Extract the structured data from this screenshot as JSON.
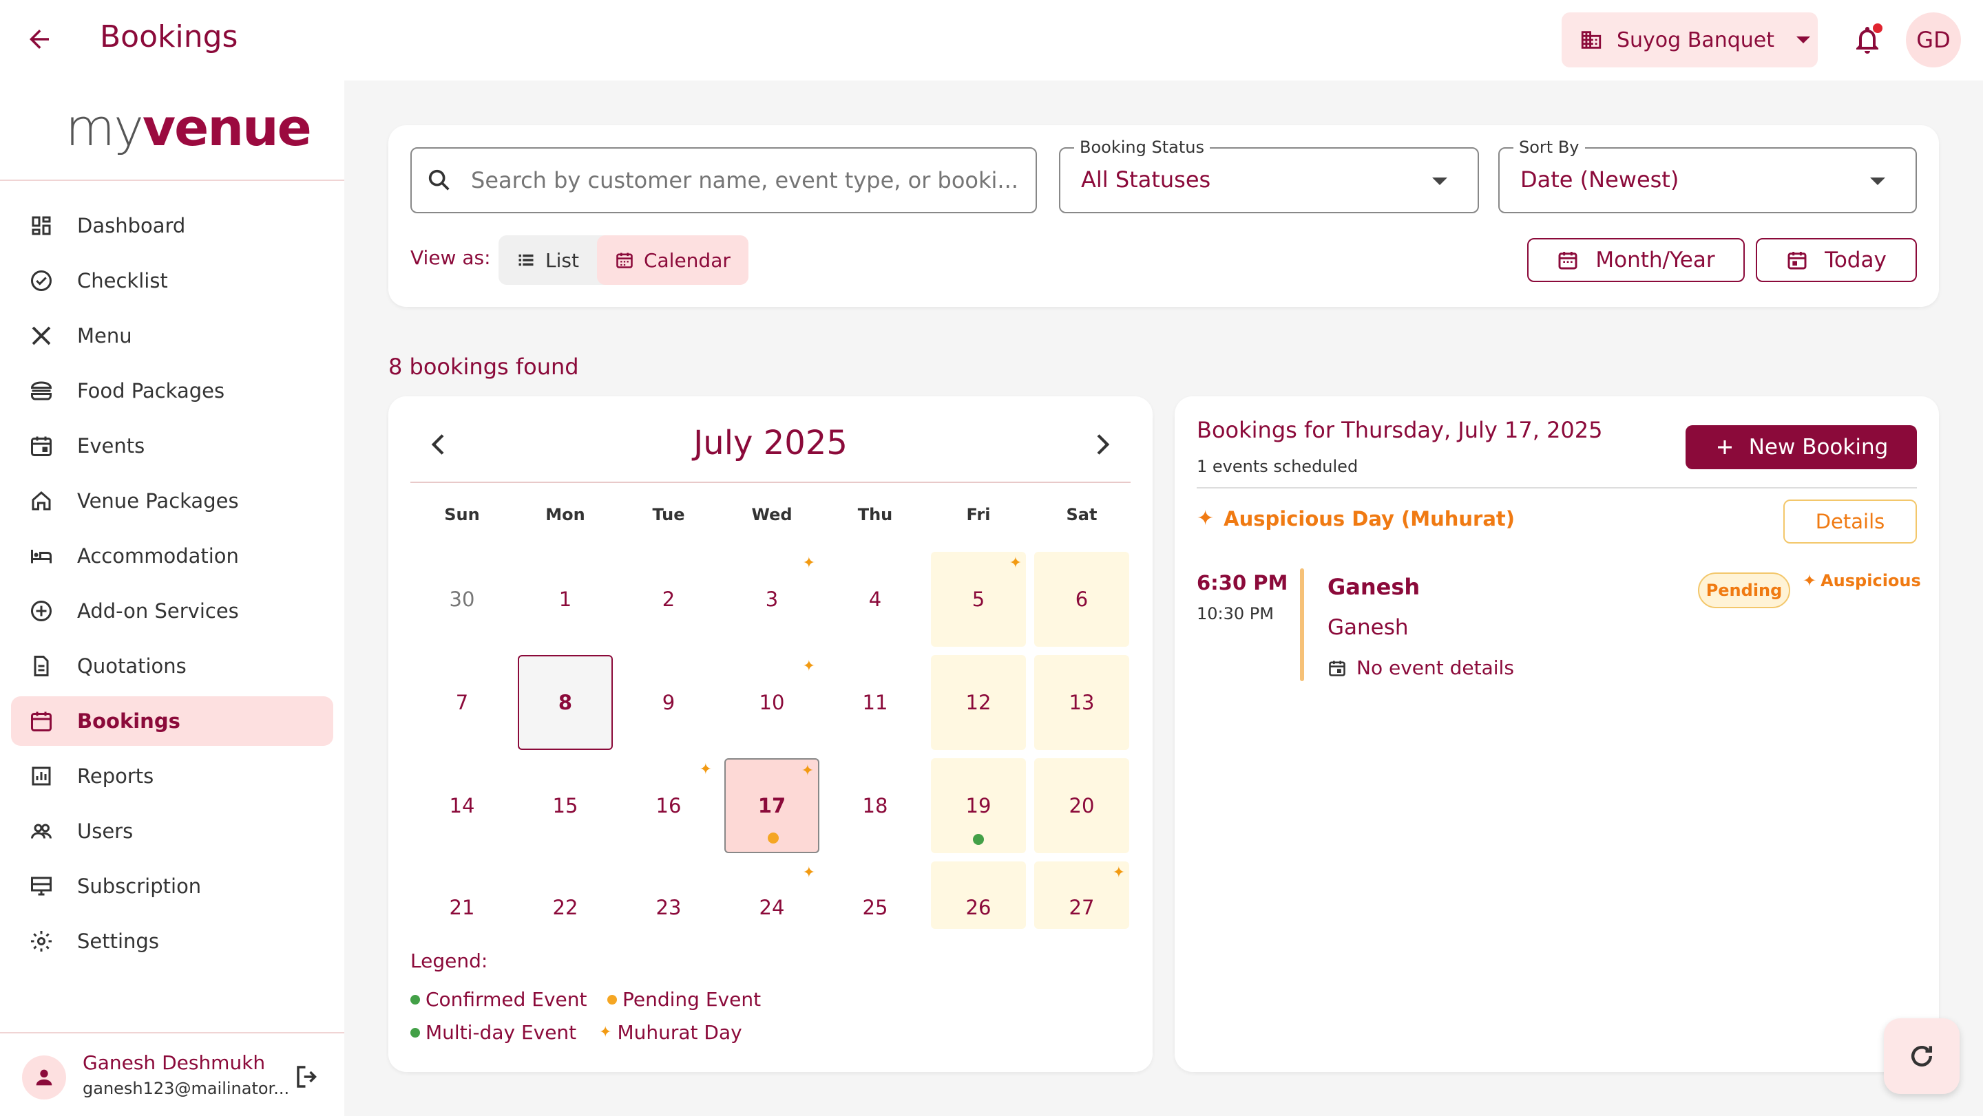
{
  "header": {
    "title": "Bookings",
    "venue": "Suyog Banquet",
    "avatar_initials": "GD"
  },
  "brand": {
    "logo_my": "my",
    "logo_venue": "venue"
  },
  "sidebar": {
    "items": [
      {
        "label": "Dashboard",
        "icon": "dashboard-icon"
      },
      {
        "label": "Checklist",
        "icon": "check-circle-icon"
      },
      {
        "label": "Menu",
        "icon": "utensils-icon"
      },
      {
        "label": "Food Packages",
        "icon": "burger-icon"
      },
      {
        "label": "Events",
        "icon": "calendar-event-icon"
      },
      {
        "label": "Venue Packages",
        "icon": "home-icon"
      },
      {
        "label": "Accommodation",
        "icon": "bed-icon"
      },
      {
        "label": "Add-on Services",
        "icon": "plus-circle-icon"
      },
      {
        "label": "Quotations",
        "icon": "document-icon"
      },
      {
        "label": "Bookings",
        "icon": "calendar-icon",
        "active": true
      },
      {
        "label": "Reports",
        "icon": "reports-icon"
      },
      {
        "label": "Users",
        "icon": "users-icon"
      },
      {
        "label": "Subscription",
        "icon": "subscription-icon"
      },
      {
        "label": "Settings",
        "icon": "gear-icon"
      }
    ],
    "user": {
      "name": "Ganesh Deshmukh",
      "email": "ganesh123@mailinator..."
    }
  },
  "filters": {
    "search_placeholder": "Search by customer name, event type, or booki...",
    "status_label": "Booking Status",
    "status_value": "All Statuses",
    "sort_label": "Sort By",
    "sort_value": "Date (Newest)",
    "view_as": "View as:",
    "view_list": "List",
    "view_calendar": "Calendar",
    "month_year": "Month/Year",
    "today": "Today"
  },
  "results": {
    "count_text": "8 bookings found"
  },
  "calendar": {
    "title": "July 2025",
    "weekdays": [
      "Sun",
      "Mon",
      "Tue",
      "Wed",
      "Thu",
      "Fri",
      "Sat"
    ],
    "weeks": [
      [
        {
          "d": "30",
          "muted": true
        },
        {
          "d": "1"
        },
        {
          "d": "2"
        },
        {
          "d": "3",
          "spark": true
        },
        {
          "d": "4"
        },
        {
          "d": "5",
          "weekend": true,
          "spark": true
        },
        {
          "d": "6",
          "weekend": true
        }
      ],
      [
        {
          "d": "7"
        },
        {
          "d": "8",
          "today": true
        },
        {
          "d": "9"
        },
        {
          "d": "10",
          "spark": true
        },
        {
          "d": "11"
        },
        {
          "d": "12",
          "weekend": true
        },
        {
          "d": "13",
          "weekend": true
        }
      ],
      [
        {
          "d": "14"
        },
        {
          "d": "15"
        },
        {
          "d": "16",
          "spark": true
        },
        {
          "d": "17",
          "selected": true,
          "spark": true,
          "dot": "pending"
        },
        {
          "d": "18"
        },
        {
          "d": "19",
          "weekend": true,
          "dot": "confirmed"
        },
        {
          "d": "20",
          "weekend": true
        }
      ],
      [
        {
          "d": "21"
        },
        {
          "d": "22"
        },
        {
          "d": "23"
        },
        {
          "d": "24",
          "spark": true
        },
        {
          "d": "25"
        },
        {
          "d": "26",
          "weekend": true
        },
        {
          "d": "27",
          "weekend": true,
          "spark": true
        }
      ]
    ],
    "legend_title": "Legend:",
    "legend": {
      "confirmed": "Confirmed Event",
      "pending": "Pending Event",
      "multiday": "Multi-day Event",
      "muhurat": "Muhurat Day"
    },
    "colors": {
      "confirmed": "#43a047",
      "pending": "#f5a623",
      "muhurat": "#f29a12"
    }
  },
  "details": {
    "title": "Bookings for Thursday, July 17, 2025",
    "subtitle": "1 events scheduled",
    "new_booking": "New Booking",
    "auspicious": "Auspicious Day (Muhurat)",
    "details_btn": "Details",
    "event": {
      "start": "6:30 PM",
      "end": "10:30 PM",
      "name": "Ganesh",
      "customer": "Ganesh",
      "info": "No event details",
      "status": "Pending",
      "tag": "Auspicious"
    }
  }
}
